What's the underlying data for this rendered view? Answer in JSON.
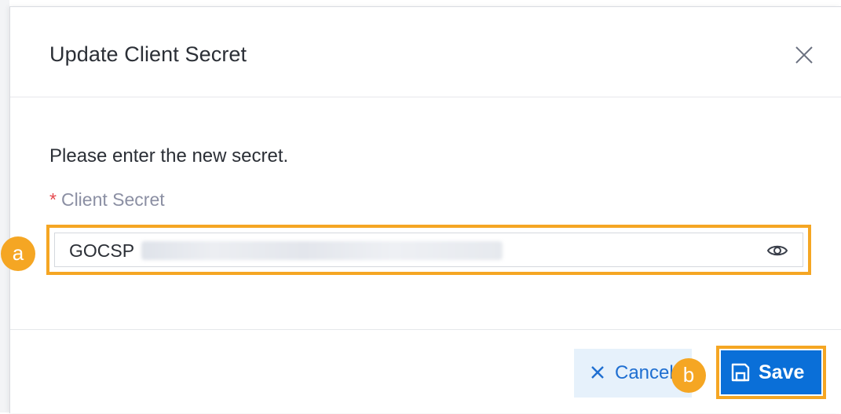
{
  "dialog": {
    "title": "Update Client Secret",
    "instruction": "Please enter the new secret.",
    "field": {
      "required_mark": "*",
      "label": "Client Secret",
      "value_visible_prefix": "GOCSP",
      "value_obscured": true
    },
    "footer": {
      "cancel_label": "Cancel",
      "save_label": "Save"
    }
  },
  "annotations": {
    "marker_a": "a",
    "marker_b": "b"
  },
  "colors": {
    "accent": "#f5a623",
    "primary": "#0a6fd8",
    "secondary_bg": "#e6f1fb",
    "required": "#e5484d"
  },
  "icons": {
    "close": "close-icon",
    "eye": "eye-icon",
    "cancel": "x-icon",
    "save": "floppy-disk-icon"
  }
}
